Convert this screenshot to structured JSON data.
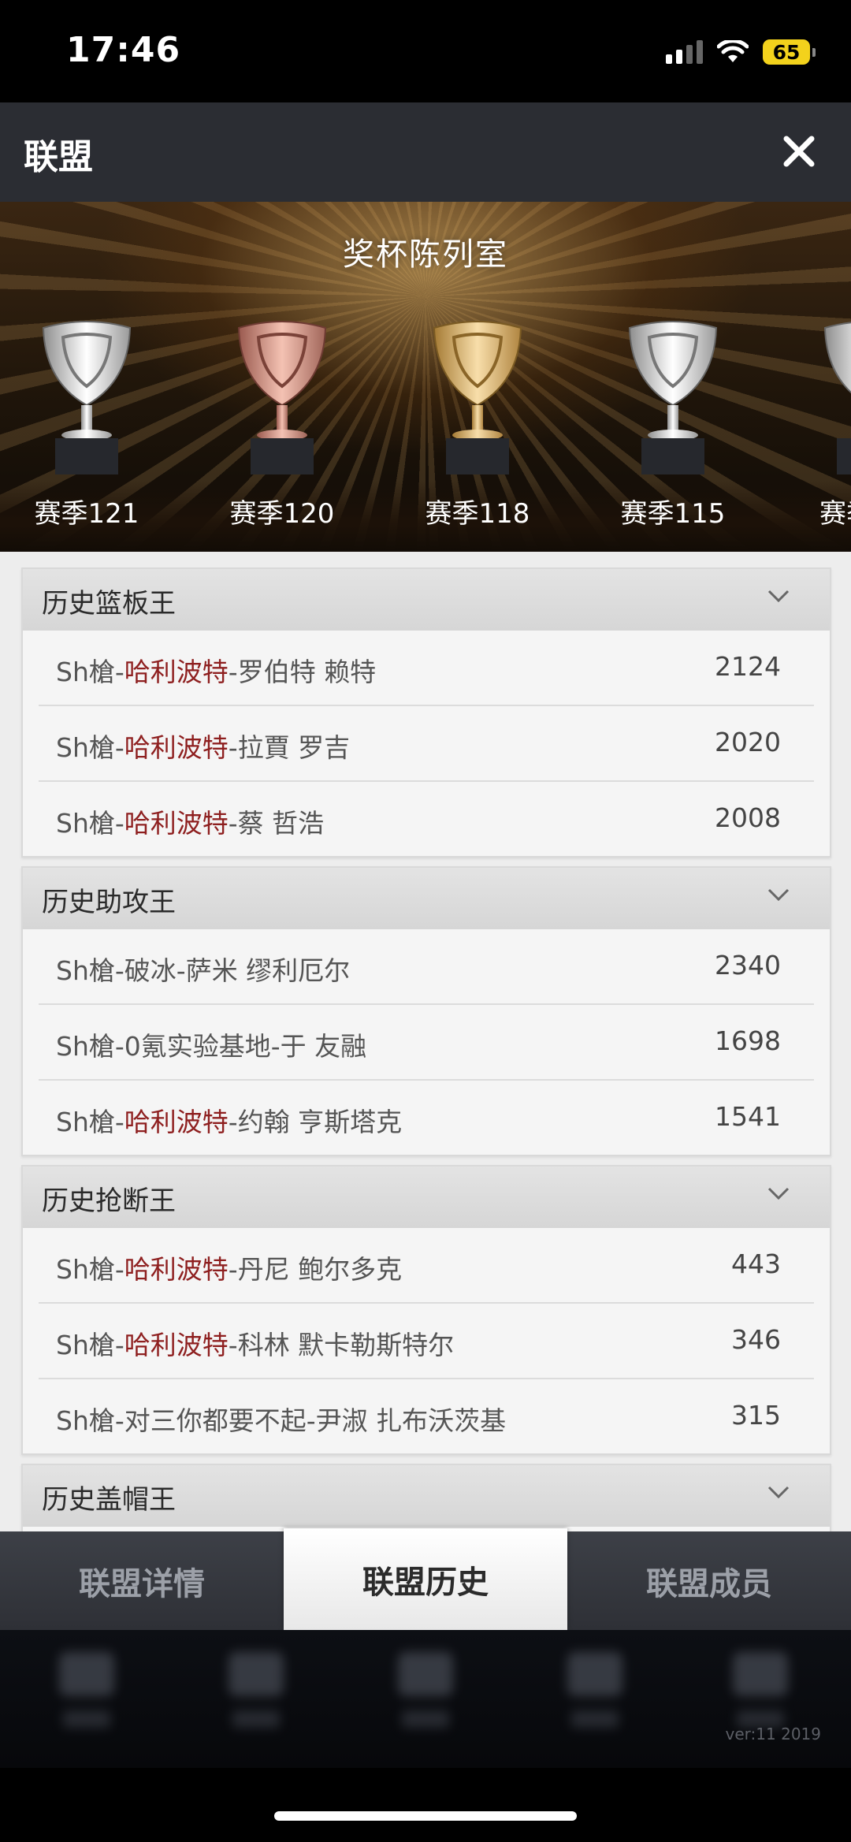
{
  "status_bar": {
    "time": "17:46",
    "battery": "65"
  },
  "header": {
    "title": "联盟"
  },
  "banner": {
    "title": "奖杯陈列室",
    "trophies": [
      {
        "label": "赛季121",
        "tier": "silver"
      },
      {
        "label": "赛季120",
        "tier": "bronze"
      },
      {
        "label": "赛季118",
        "tier": "gold"
      },
      {
        "label": "赛季115",
        "tier": "silver"
      },
      {
        "label": "赛季",
        "tier": "silver"
      }
    ]
  },
  "sections": [
    {
      "title": "历史篮板王",
      "rows": [
        {
          "prefix": "Sh槍-",
          "team": "哈利波特",
          "player": "-罗伯特 赖特",
          "value": "2124"
        },
        {
          "prefix": "Sh槍-",
          "team": "哈利波特",
          "player": "-拉賈 罗吉",
          "value": "2020"
        },
        {
          "prefix": "Sh槍-",
          "team": "哈利波特",
          "player": "-蔡 哲浩",
          "value": "2008"
        }
      ]
    },
    {
      "title": "历史助攻王",
      "rows": [
        {
          "prefix": "Sh槍-",
          "team": "",
          "player": "破冰-萨米 缪利厄尔",
          "value": "2340"
        },
        {
          "prefix": "Sh槍-",
          "team": "",
          "player": "0氪实验基地-于 友融",
          "value": "1698"
        },
        {
          "prefix": "Sh槍-",
          "team": "哈利波特",
          "player": "-约翰 亨斯塔克",
          "value": "1541"
        }
      ]
    },
    {
      "title": "历史抢断王",
      "rows": [
        {
          "prefix": "Sh槍-",
          "team": "哈利波特",
          "player": "-丹尼 鲍尔多克",
          "value": "443"
        },
        {
          "prefix": "Sh槍-",
          "team": "哈利波特",
          "player": "-科林 默卡勒斯特尔",
          "value": "346"
        },
        {
          "prefix": "Sh槍-",
          "team": "",
          "player": "对三你都要不起-尹淑 扎布沃茨基",
          "value": "315"
        }
      ]
    },
    {
      "title": "历史盖帽王",
      "rows": []
    }
  ],
  "tabs": [
    {
      "label": "联盟详情",
      "active": false
    },
    {
      "label": "联盟历史",
      "active": true
    },
    {
      "label": "联盟成员",
      "active": false
    }
  ],
  "footer": {
    "version": "ver:11  2019"
  },
  "colors": {
    "team_highlight": "#8e1f1f",
    "header_bg": "#2b2d33",
    "content_bg": "#ededed"
  }
}
